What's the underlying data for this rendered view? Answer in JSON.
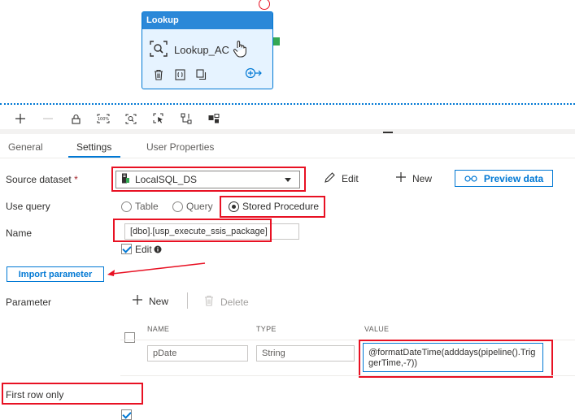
{
  "node": {
    "header": "Lookup",
    "name": "Lookup_AC"
  },
  "tabs": {
    "general": "General",
    "settings": "Settings",
    "user_properties": "User Properties"
  },
  "source": {
    "label": "Source dataset",
    "required": "*",
    "value": "LocalSQL_DS",
    "edit": "Edit",
    "new": "New",
    "preview": "Preview data"
  },
  "use_query": {
    "label": "Use query",
    "options": [
      "Table",
      "Query",
      "Stored Procedure"
    ],
    "selected": "Stored Procedure"
  },
  "name": {
    "label": "Name",
    "value": "[dbo].[usp_execute_ssis_package]",
    "edit": "Edit"
  },
  "import_parameter": "Import parameter",
  "parameter": {
    "label": "Parameter",
    "new": "New",
    "delete": "Delete",
    "columns": [
      "NAME",
      "TYPE",
      "VALUE"
    ],
    "rows": [
      {
        "name": "pDate",
        "type": "String",
        "value": "@formatDateTime(adddays(pipeline().TriggerTime,-7))"
      }
    ]
  },
  "first_row_only": "First row only",
  "icons": {
    "node": "search-icon",
    "actions": [
      "delete-icon",
      "code-icon",
      "copy-icon",
      "add-next-icon"
    ],
    "toolbar": [
      "add-icon",
      "remove-icon",
      "lock-icon",
      "zoom-100-icon",
      "zoom-fit-icon",
      "select-icon",
      "auto-align-icon",
      "layout-icon"
    ]
  },
  "colors": {
    "accent": "#0078d4",
    "highlight": "#e81123",
    "node_header": "#2b88d8"
  }
}
